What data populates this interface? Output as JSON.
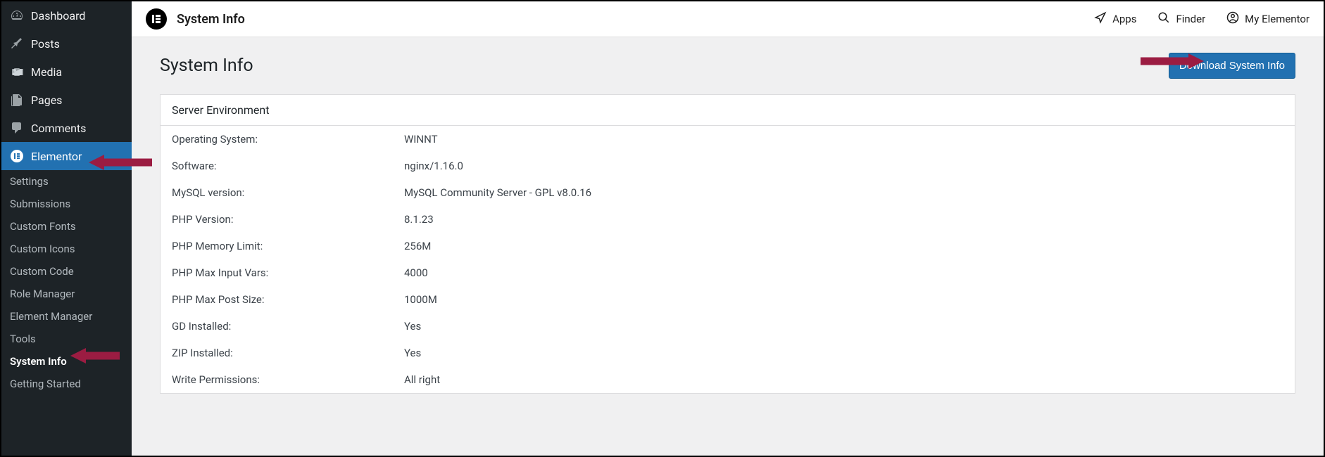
{
  "sidebar": {
    "main_items": [
      {
        "label": "Dashboard",
        "icon": "dashboard"
      },
      {
        "label": "Posts",
        "icon": "pin"
      },
      {
        "label": "Media",
        "icon": "media"
      },
      {
        "label": "Pages",
        "icon": "pages"
      },
      {
        "label": "Comments",
        "icon": "comment"
      },
      {
        "label": "Elementor",
        "icon": "elementor",
        "active": true
      }
    ],
    "sub_items": [
      {
        "label": "Settings"
      },
      {
        "label": "Submissions"
      },
      {
        "label": "Custom Fonts"
      },
      {
        "label": "Custom Icons"
      },
      {
        "label": "Custom Code"
      },
      {
        "label": "Role Manager"
      },
      {
        "label": "Element Manager"
      },
      {
        "label": "Tools"
      },
      {
        "label": "System Info",
        "current": true
      },
      {
        "label": "Getting Started"
      }
    ]
  },
  "topbar": {
    "title": "System Info",
    "links": [
      {
        "label": "Apps",
        "icon": "apps"
      },
      {
        "label": "Finder",
        "icon": "search"
      },
      {
        "label": "My Elementor",
        "icon": "user"
      }
    ]
  },
  "page": {
    "title": "System Info",
    "download_button": "Download System Info"
  },
  "server_env": {
    "title": "Server Environment",
    "rows": [
      {
        "label": "Operating System:",
        "value": "WINNT"
      },
      {
        "label": "Software:",
        "value": "nginx/1.16.0"
      },
      {
        "label": "MySQL version:",
        "value": "MySQL Community Server - GPL v8.0.16"
      },
      {
        "label": "PHP Version:",
        "value": "8.1.23"
      },
      {
        "label": "PHP Memory Limit:",
        "value": "256M"
      },
      {
        "label": "PHP Max Input Vars:",
        "value": "4000"
      },
      {
        "label": "PHP Max Post Size:",
        "value": "1000M"
      },
      {
        "label": "GD Installed:",
        "value": "Yes"
      },
      {
        "label": "ZIP Installed:",
        "value": "Yes"
      },
      {
        "label": "Write Permissions:",
        "value": "All right"
      }
    ]
  }
}
